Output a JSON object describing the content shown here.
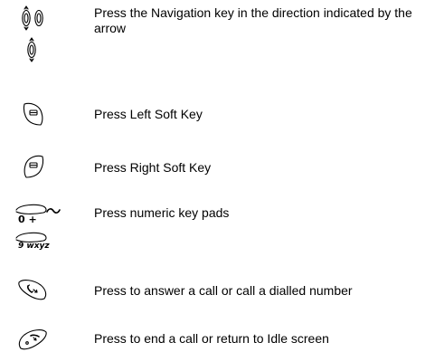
{
  "legend": [
    {
      "icon": "navigation-key-icon",
      "description": "Press the Navigation key in the direction indicated by the arrow"
    },
    {
      "icon": "left-soft-key-icon",
      "description": "Press Left Soft Key"
    },
    {
      "icon": "right-soft-key-icon",
      "description": "Press Right Soft Key"
    },
    {
      "icon": "numeric-keypad-icon",
      "description": "Press numeric key pads",
      "key_labels": [
        "0 +",
        "9 wxyz"
      ]
    },
    {
      "icon": "answer-call-key-icon",
      "description": "Press to answer a call or call a dialled number"
    },
    {
      "icon": "end-call-key-icon",
      "description": "Press to end a call or return to Idle screen"
    }
  ]
}
